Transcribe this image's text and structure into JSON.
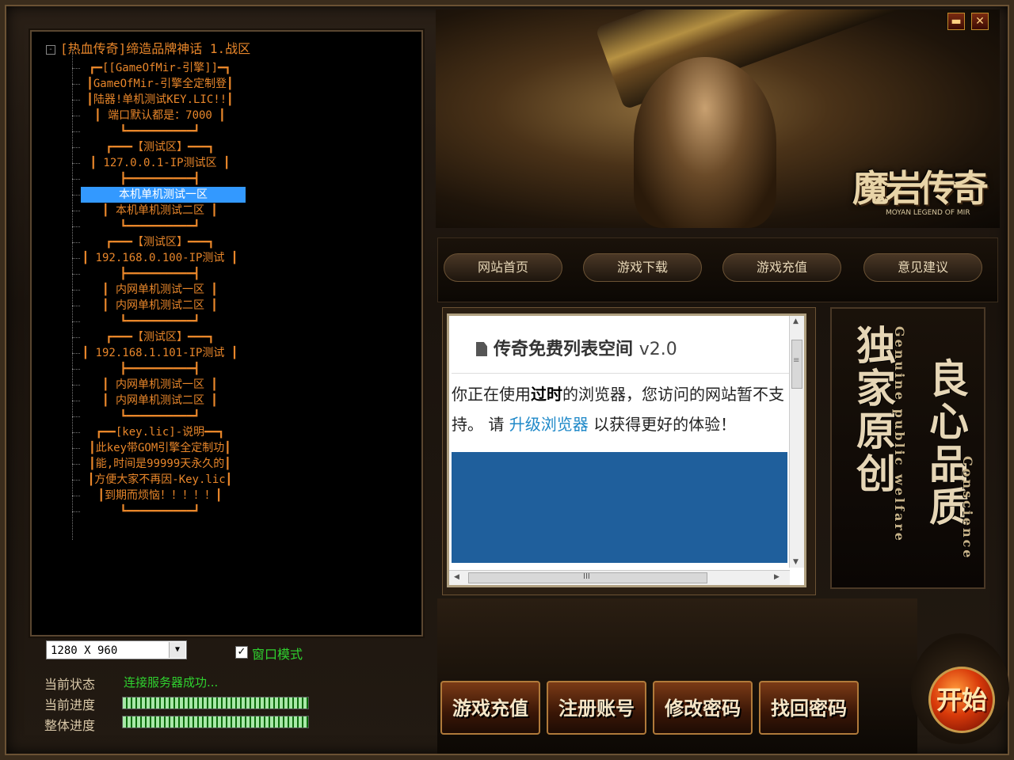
{
  "window": {
    "minimize_glyph": "▬",
    "close_glyph": "✕"
  },
  "tree": {
    "root_toggle": "-",
    "root_label": "[热血传奇]缔造品牌神话 1.战区",
    "items": [
      {
        "text": "┏━[[GameOfMir-引擎]]━┓"
      },
      {
        "text": "┃GameOfMir-引擎全定制登┃"
      },
      {
        "text": "┃陆器!单机测试KEY.LIC!!┃"
      },
      {
        "text": "┃ 端口默认都是：7000 ┃"
      },
      {
        "text": "┗━━━━━━━━━━┛"
      },
      {
        "text": "┏━━━【测试区】━━━┓"
      },
      {
        "text": "┃ 127.0.0.1-IP测试区 ┃"
      },
      {
        "text": "┣━━━━━━━━━━┫"
      },
      {
        "text": "┃ 本机单机测试一区 ┃"
      },
      {
        "text": "┃ 本机单机测试二区 ┃"
      },
      {
        "text": "┗━━━━━━━━━━┛"
      },
      {
        "text": "┏━━━【测试区】━━━┓"
      },
      {
        "text": "┃ 192.168.0.100-IP测试 ┃"
      },
      {
        "text": "┣━━━━━━━━━━┫"
      },
      {
        "text": "┃ 内网单机测试一区 ┃"
      },
      {
        "text": "┃ 内网单机测试二区 ┃"
      },
      {
        "text": "┗━━━━━━━━━━┛"
      },
      {
        "text": "┏━━━【测试区】━━━┓"
      },
      {
        "text": "┃ 192.168.1.101-IP测试 ┃"
      },
      {
        "text": "┣━━━━━━━━━━┫"
      },
      {
        "text": "┃ 内网单机测试一区 ┃"
      },
      {
        "text": "┃ 内网单机测试二区 ┃"
      },
      {
        "text": "┗━━━━━━━━━━┛"
      },
      {
        "text": "┏━━[key.lic]-说明━━┓"
      },
      {
        "text": "┃此key带GOM引擎全定制功┃"
      },
      {
        "text": "┃能,时间是99999天永久的┃"
      },
      {
        "text": "┃方便大家不再因-Key.lic┃"
      },
      {
        "text": "┃到期而烦恼！！！！！┃"
      },
      {
        "text": "┗━━━━━━━━━━┛"
      }
    ],
    "selected_label": "本机单机测试一区"
  },
  "controls": {
    "resolution": "1280 X 960",
    "dropdown_glyph": "▼",
    "window_mode_checked": "✓",
    "window_mode_label": "窗口模式",
    "status_label": "当前状态",
    "status_value": "连接服务器成功...",
    "progress_label": "当前进度",
    "total_label": "整体进度",
    "current_progress": 1.0,
    "total_progress": 1.0
  },
  "banner": {
    "logo_text": "魔岩传奇",
    "logo_sub": "MOYAN LEGEND OF MIR"
  },
  "nav": [
    {
      "label": "网站首页"
    },
    {
      "label": "游戏下载"
    },
    {
      "label": "游戏充值"
    },
    {
      "label": "意见建议"
    }
  ],
  "browser": {
    "title": "传奇免费列表空间",
    "version": "v2.0",
    "msg_part1": "你正在使用",
    "msg_bold": "过时",
    "msg_part2": "的浏览器，您访问的网站暂不支持。 请 ",
    "msg_link": "升级浏览器",
    "msg_part3": " 以获得更好的体验！",
    "arrow_up": "▲",
    "arrow_down": "▼",
    "arrow_left": "◀",
    "arrow_right": "▶",
    "grip": "III",
    "vgrip": "≡"
  },
  "side": {
    "col1": "独家原创",
    "col2": "Genuine public welfare",
    "col3": "良心品质",
    "col4": "Conscience"
  },
  "buttons": {
    "recharge": "游戏充值",
    "register": "注册账号",
    "change_pwd": "修改密码",
    "recover_pwd": "找回密码",
    "start": "开始"
  },
  "colors": {
    "tree_text": "#e8862a",
    "selection": "#3399ff",
    "status_green": "#2fd12f",
    "link_blue": "#1e88c8"
  }
}
